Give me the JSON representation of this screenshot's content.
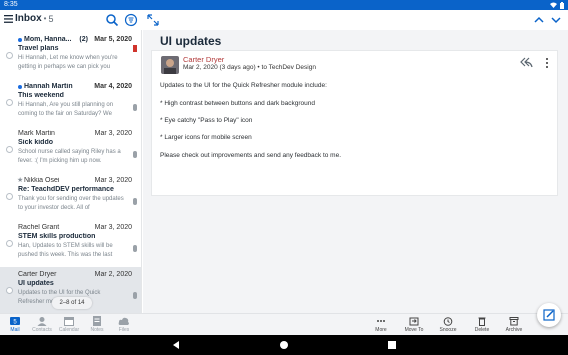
{
  "status_bar": {
    "time": "8:35"
  },
  "header": {
    "inbox_label": "Inbox",
    "separator": "•",
    "inbox_count": "5"
  },
  "messages": [
    {
      "sender": "Mom, Hanna...",
      "thread_count": "(2)",
      "date": "Mar 5, 2020",
      "subject": "Travel plans",
      "preview": "Hi Hannah, Let me know when you're getting in perhaps we can pick you",
      "unread": true,
      "flagged": true
    },
    {
      "sender": "Hannah Martin",
      "date": "Mar 4, 2020",
      "subject": "This weekend",
      "preview": "Hi Hannah, Are you still planning on coming to the fair on Saturday? We",
      "unread": true
    },
    {
      "sender": "Mark Martin",
      "date": "Mar 3, 2020",
      "subject": "Sick kiddo",
      "preview": "School nurse called saying Riley has a fever. :( I'm picking him up now.",
      "unread": false
    },
    {
      "sender": "Nikkia Osei",
      "date": "Mar 3, 2020",
      "subject": "Re: TeachdDEV performance",
      "preview": "Thank you for sending over the updates to your investor deck. All of",
      "unread": false,
      "starred": true
    },
    {
      "sender": "Rachel Grant",
      "date": "Mar 3, 2020",
      "subject": "STEM skills production",
      "preview": "Han, Updates to STEM skills will be pushed this week. This was the last",
      "unread": false
    },
    {
      "sender": "Carter Dryer",
      "date": "Mar 2, 2020",
      "subject": "UI updates",
      "preview": "Updates to the UI for the Quick Refresher module include:",
      "unread": false,
      "selected": true
    }
  ],
  "pager": {
    "text": "2–8 of 14"
  },
  "reading_pane": {
    "subject": "UI updates",
    "from": "Carter Dryer",
    "meta": "Mar 2, 2020 (3 days ago) • to TechDev Design",
    "body": [
      "Updates to the UI for the Quick Refresher module include:",
      "* High contrast between buttons and dark background",
      "* Eye catchy \"Pass to Play\" icon",
      "* Larger icons for mobile screen",
      "Please check out improvements and send any feedback to me."
    ]
  },
  "nav_tabs": [
    {
      "label": "Mail",
      "icon": "mail-icon",
      "badge": "5",
      "active": true
    },
    {
      "label": "Contacts",
      "icon": "contacts-icon"
    },
    {
      "label": "Calendar",
      "icon": "calendar-icon"
    },
    {
      "label": "Notes",
      "icon": "notes-icon"
    },
    {
      "label": "Files",
      "icon": "files-icon"
    }
  ],
  "actions": [
    {
      "label": "More",
      "icon": "more-icon"
    },
    {
      "label": "Move To",
      "icon": "move-to-icon"
    },
    {
      "label": "Snooze",
      "icon": "snooze-icon"
    },
    {
      "label": "Delete",
      "icon": "delete-icon"
    },
    {
      "label": "Archive",
      "icon": "archive-icon"
    }
  ],
  "colors": {
    "brand_blue": "#0a63c9",
    "unread_dot": "#1a6ce0",
    "sender_red": "#b23a3a",
    "flag_red": "#d0342c",
    "selected_bg": "#e3e6ea"
  }
}
